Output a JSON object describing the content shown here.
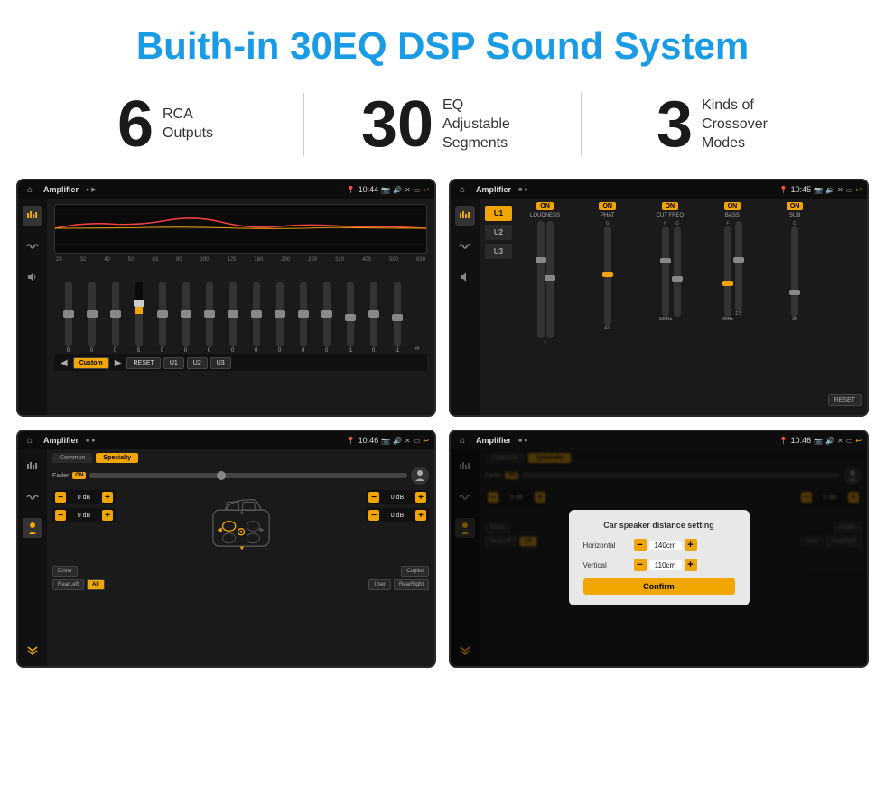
{
  "header": {
    "title": "Buith-in 30EQ DSP Sound System"
  },
  "stats": [
    {
      "number": "6",
      "label": "RCA\nOutputs"
    },
    {
      "number": "30",
      "label": "EQ Adjustable\nSegments"
    },
    {
      "number": "3",
      "label": "Kinds of\nCrossover Modes"
    }
  ],
  "screen1": {
    "title": "Amplifier",
    "time": "10:44",
    "eq_freqs": [
      "25",
      "32",
      "40",
      "50",
      "63",
      "80",
      "100",
      "125",
      "160",
      "200",
      "250",
      "320",
      "400",
      "500",
      "630"
    ],
    "eq_values": [
      "0",
      "0",
      "0",
      "5",
      "0",
      "0",
      "0",
      "0",
      "0",
      "0",
      "0",
      "0",
      "-1",
      "0",
      "-1"
    ],
    "preset": "Custom",
    "btns": [
      "RESET",
      "U1",
      "U2",
      "U3"
    ]
  },
  "screen2": {
    "title": "Amplifier",
    "time": "10:45",
    "presets": [
      "U1",
      "U2",
      "U3"
    ],
    "channels": [
      "LOUDNESS",
      "PHAT",
      "CUT FREQ",
      "BASS",
      "SUB"
    ],
    "on_labels": [
      "ON",
      "ON",
      "ON",
      "ON",
      "ON"
    ],
    "reset_label": "RESET"
  },
  "screen3": {
    "title": "Amplifier",
    "time": "10:46",
    "tabs": [
      "Common",
      "Specialty"
    ],
    "fader_label": "Fader",
    "fader_on": "ON",
    "positions": [
      "Driver",
      "Copilot",
      "RearLeft",
      "RearRight"
    ],
    "all_btn": "All",
    "user_btn": "User",
    "vol_values": [
      "0 dB",
      "0 dB",
      "0 dB",
      "0 dB"
    ]
  },
  "screen4": {
    "title": "Amplifier",
    "time": "10:46",
    "dialog": {
      "title": "Car speaker distance setting",
      "horizontal_label": "Horizontal",
      "horizontal_value": "140cm",
      "vertical_label": "Vertical",
      "vertical_value": "110cm",
      "confirm_label": "Confirm"
    },
    "vol_values": [
      "0 dB",
      "0 dB"
    ],
    "positions": [
      "Driver",
      "Copilot",
      "RearLeft",
      "RearRight"
    ]
  }
}
